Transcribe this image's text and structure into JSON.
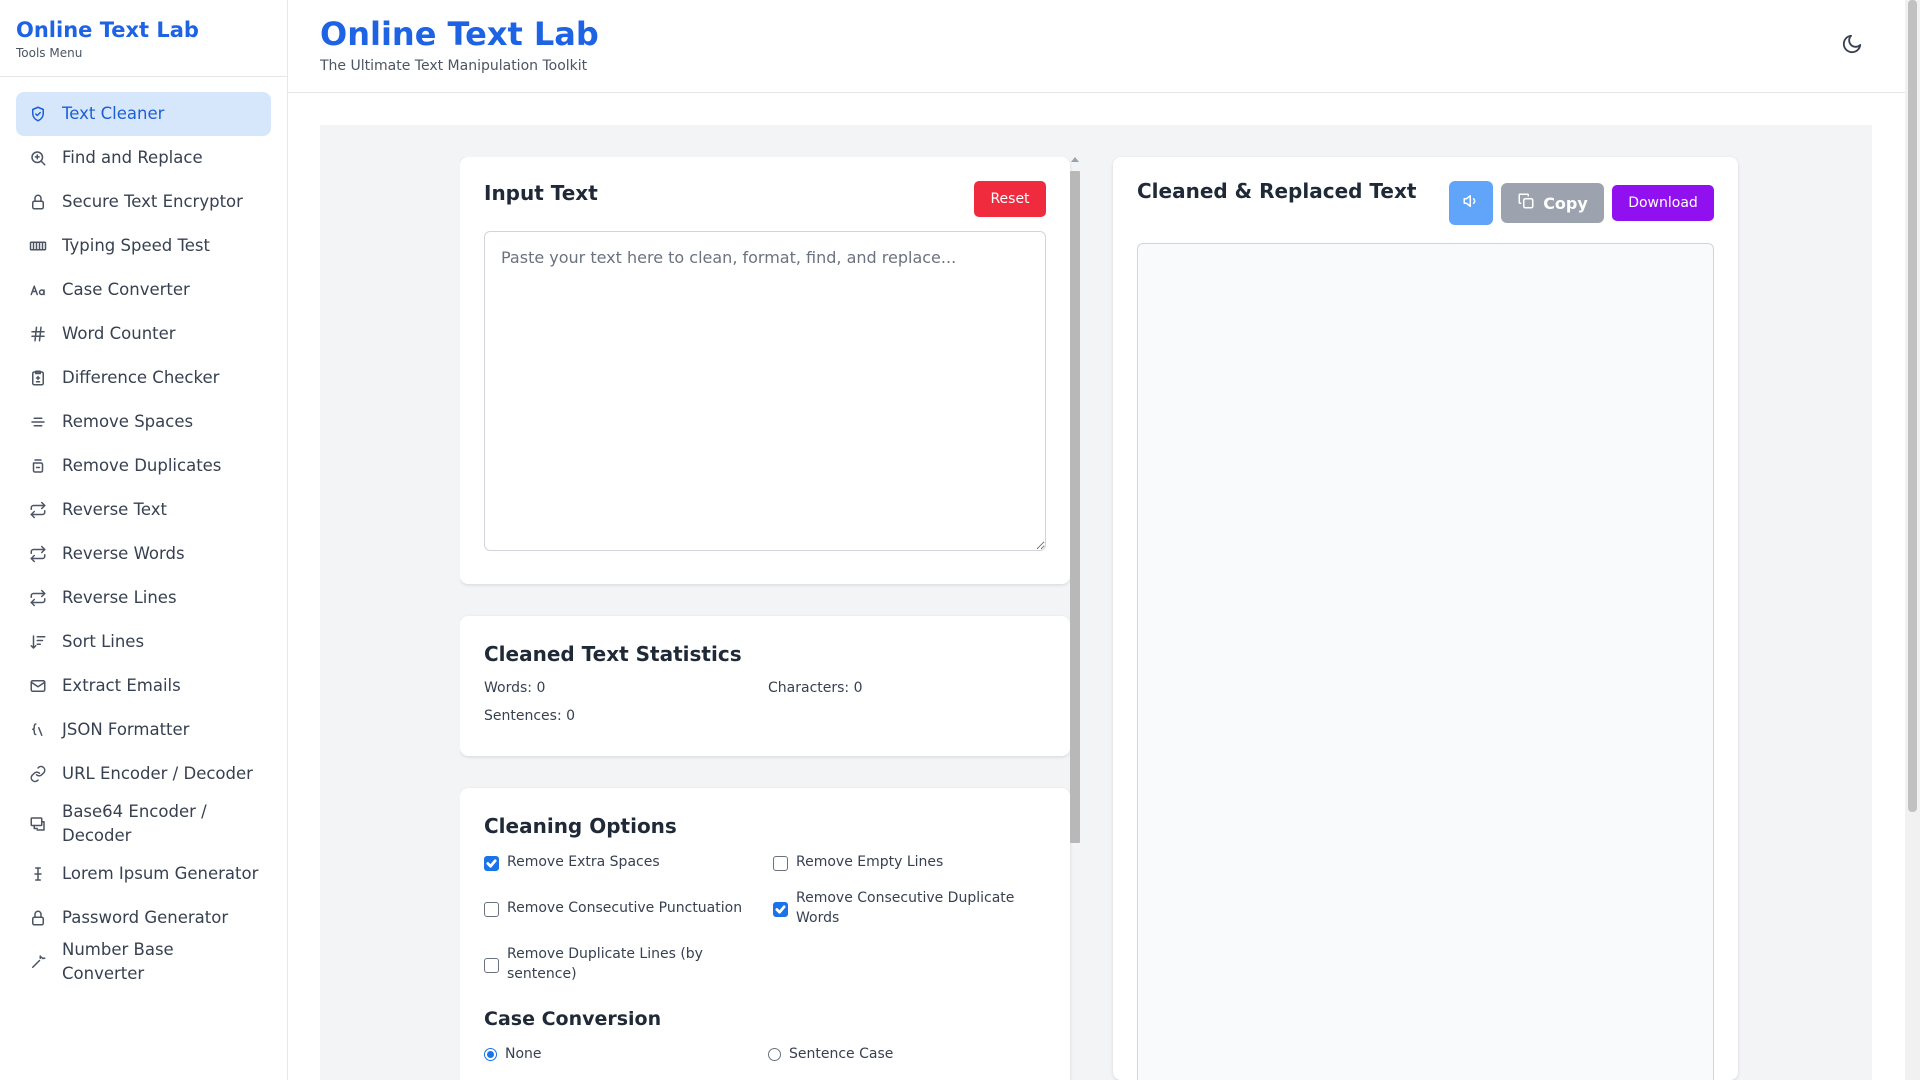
{
  "sidebar": {
    "brand": "Online Text Lab",
    "subtitle": "Tools Menu",
    "items": [
      {
        "label": "Text Cleaner",
        "icon": "shield-check-icon"
      },
      {
        "label": "Find and Replace",
        "icon": "search-replace-icon"
      },
      {
        "label": "Secure Text Encryptor",
        "icon": "lock-icon"
      },
      {
        "label": "Typing Speed Test",
        "icon": "keyboard-icon"
      },
      {
        "label": "Case Converter",
        "icon": "case-icon"
      },
      {
        "label": "Word Counter",
        "icon": "hash-icon"
      },
      {
        "label": "Difference Checker",
        "icon": "clipboard-diff-icon"
      },
      {
        "label": "Remove Spaces",
        "icon": "strikethrough-icon"
      },
      {
        "label": "Remove Duplicates",
        "icon": "duplicate-icon"
      },
      {
        "label": "Reverse Text",
        "icon": "repeat-icon"
      },
      {
        "label": "Reverse Words",
        "icon": "repeat-icon"
      },
      {
        "label": "Reverse Lines",
        "icon": "repeat-icon"
      },
      {
        "label": "Sort Lines",
        "icon": "sort-icon"
      },
      {
        "label": "Extract Emails",
        "icon": "mail-icon"
      },
      {
        "label": "JSON Formatter",
        "icon": "json-icon"
      },
      {
        "label": "URL Encoder / Decoder",
        "icon": "link-icon"
      },
      {
        "label": "Base64 Encoder /\nDecoder",
        "icon": "encode-icon"
      },
      {
        "label": "Lorem Ipsum Generator",
        "icon": "text-cursor-icon"
      },
      {
        "label": "Password Generator",
        "icon": "lock-icon"
      },
      {
        "label": "Number Base Converter",
        "icon": "wand-icon"
      }
    ]
  },
  "header": {
    "title": "Online Text Lab",
    "subtitle": "The Ultimate Text Manipulation Toolkit"
  },
  "input_card": {
    "title": "Input Text",
    "reset_label": "Reset",
    "placeholder": "Paste your text here to clean, format, find, and replace...",
    "value": ""
  },
  "stats_card": {
    "title": "Cleaned Text Statistics",
    "words": "Words: 0",
    "characters": "Characters: 0",
    "sentences": "Sentences: 0"
  },
  "options_card": {
    "title": "Cleaning Options",
    "options": [
      {
        "label": "Remove Extra Spaces",
        "checked": true
      },
      {
        "label": "Remove Empty Lines",
        "checked": false
      },
      {
        "label": "Remove Consecutive Punctuation",
        "checked": false
      },
      {
        "label": "Remove Consecutive Duplicate Words",
        "checked": true
      },
      {
        "label": "Remove Duplicate Lines (by sentence)",
        "checked": false
      }
    ],
    "case_title": "Case Conversion",
    "case_options": [
      {
        "label": "None",
        "selected": true
      },
      {
        "label": "Sentence Case",
        "selected": false
      }
    ]
  },
  "output_card": {
    "title": "Cleaned & Replaced Text",
    "copy_label": "Copy",
    "download_label": "Download",
    "value": ""
  },
  "colors": {
    "brand": "#1d63e4",
    "reset": "#ef2b3d",
    "speak": "#60a5fa",
    "copy": "#9ca3af",
    "download": "#9110f0",
    "active_nav": "#d6e6fb"
  }
}
